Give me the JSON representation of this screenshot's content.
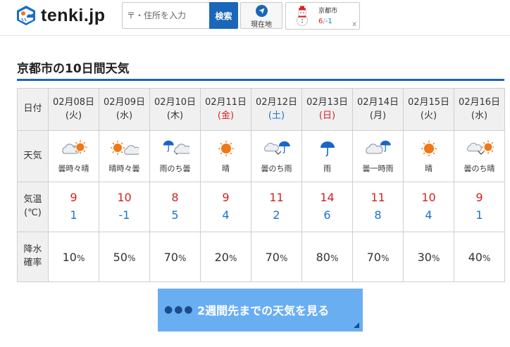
{
  "header": {
    "logo_text": "tenki.jp",
    "search_placeholder": "〒・住所を入力",
    "search_button": "検索",
    "location_button": "現在地",
    "mini_weather": {
      "city": "京都市",
      "high": "6",
      "separator": "/",
      "low": "-1",
      "close": "x",
      "icon": "snowman-icon"
    }
  },
  "page": {
    "title": "京都市の10日間天気"
  },
  "table": {
    "labels": {
      "date": "日付",
      "weather": "天気",
      "temp_line1": "気温",
      "temp_line2": "(℃)",
      "precip_line1": "降水",
      "precip_line2": "確率"
    },
    "days": [
      {
        "date": "02月08日",
        "dow": "(火)",
        "dow_type": "weekday",
        "icon": "cloudy-sometimes-sunny-icon",
        "weather": "曇時々晴",
        "high": "9",
        "low": "1",
        "precip": "10",
        "unit": "%"
      },
      {
        "date": "02月09日",
        "dow": "(水)",
        "dow_type": "weekday",
        "icon": "sunny-sometimes-cloudy-icon",
        "weather": "晴時々曇",
        "high": "10",
        "low": "-1",
        "precip": "50",
        "unit": "%"
      },
      {
        "date": "02月10日",
        "dow": "(木)",
        "dow_type": "weekday",
        "icon": "rain-then-cloudy-icon",
        "weather": "雨のち曇",
        "high": "8",
        "low": "5",
        "precip": "70",
        "unit": "%"
      },
      {
        "date": "02月11日",
        "dow": "(金)",
        "dow_type": "holiday",
        "icon": "sunny-icon",
        "weather": "晴",
        "high": "9",
        "low": "4",
        "precip": "20",
        "unit": "%"
      },
      {
        "date": "02月12日",
        "dow": "(土)",
        "dow_type": "saturday",
        "icon": "cloudy-then-rain-icon",
        "weather": "曇のち雨",
        "high": "11",
        "low": "2",
        "precip": "70",
        "unit": "%"
      },
      {
        "date": "02月13日",
        "dow": "(日)",
        "dow_type": "sunday",
        "icon": "rain-icon",
        "weather": "雨",
        "high": "14",
        "low": "6",
        "precip": "80",
        "unit": "%"
      },
      {
        "date": "02月14日",
        "dow": "(月)",
        "dow_type": "weekday",
        "icon": "cloudy-temporarily-rain-icon",
        "weather": "曇一時雨",
        "high": "11",
        "low": "8",
        "precip": "70",
        "unit": "%"
      },
      {
        "date": "02月15日",
        "dow": "(火)",
        "dow_type": "weekday",
        "icon": "sunny-icon",
        "weather": "晴",
        "high": "10",
        "low": "4",
        "precip": "30",
        "unit": "%"
      },
      {
        "date": "02月16日",
        "dow": "(水)",
        "dow_type": "weekday",
        "icon": "cloudy-then-sunny-icon",
        "weather": "曇のち晴",
        "high": "9",
        "low": "1",
        "precip": "40",
        "unit": "%"
      }
    ]
  },
  "cta": {
    "label": "2週間先までの天気を見る"
  },
  "colors": {
    "brand_blue": "#1a66b8",
    "cta_blue": "#6aaef2",
    "high_red": "#d62020",
    "low_blue": "#1a73c8",
    "sun_orange": "#f07818",
    "umbrella_blue": "#1a66c8"
  }
}
